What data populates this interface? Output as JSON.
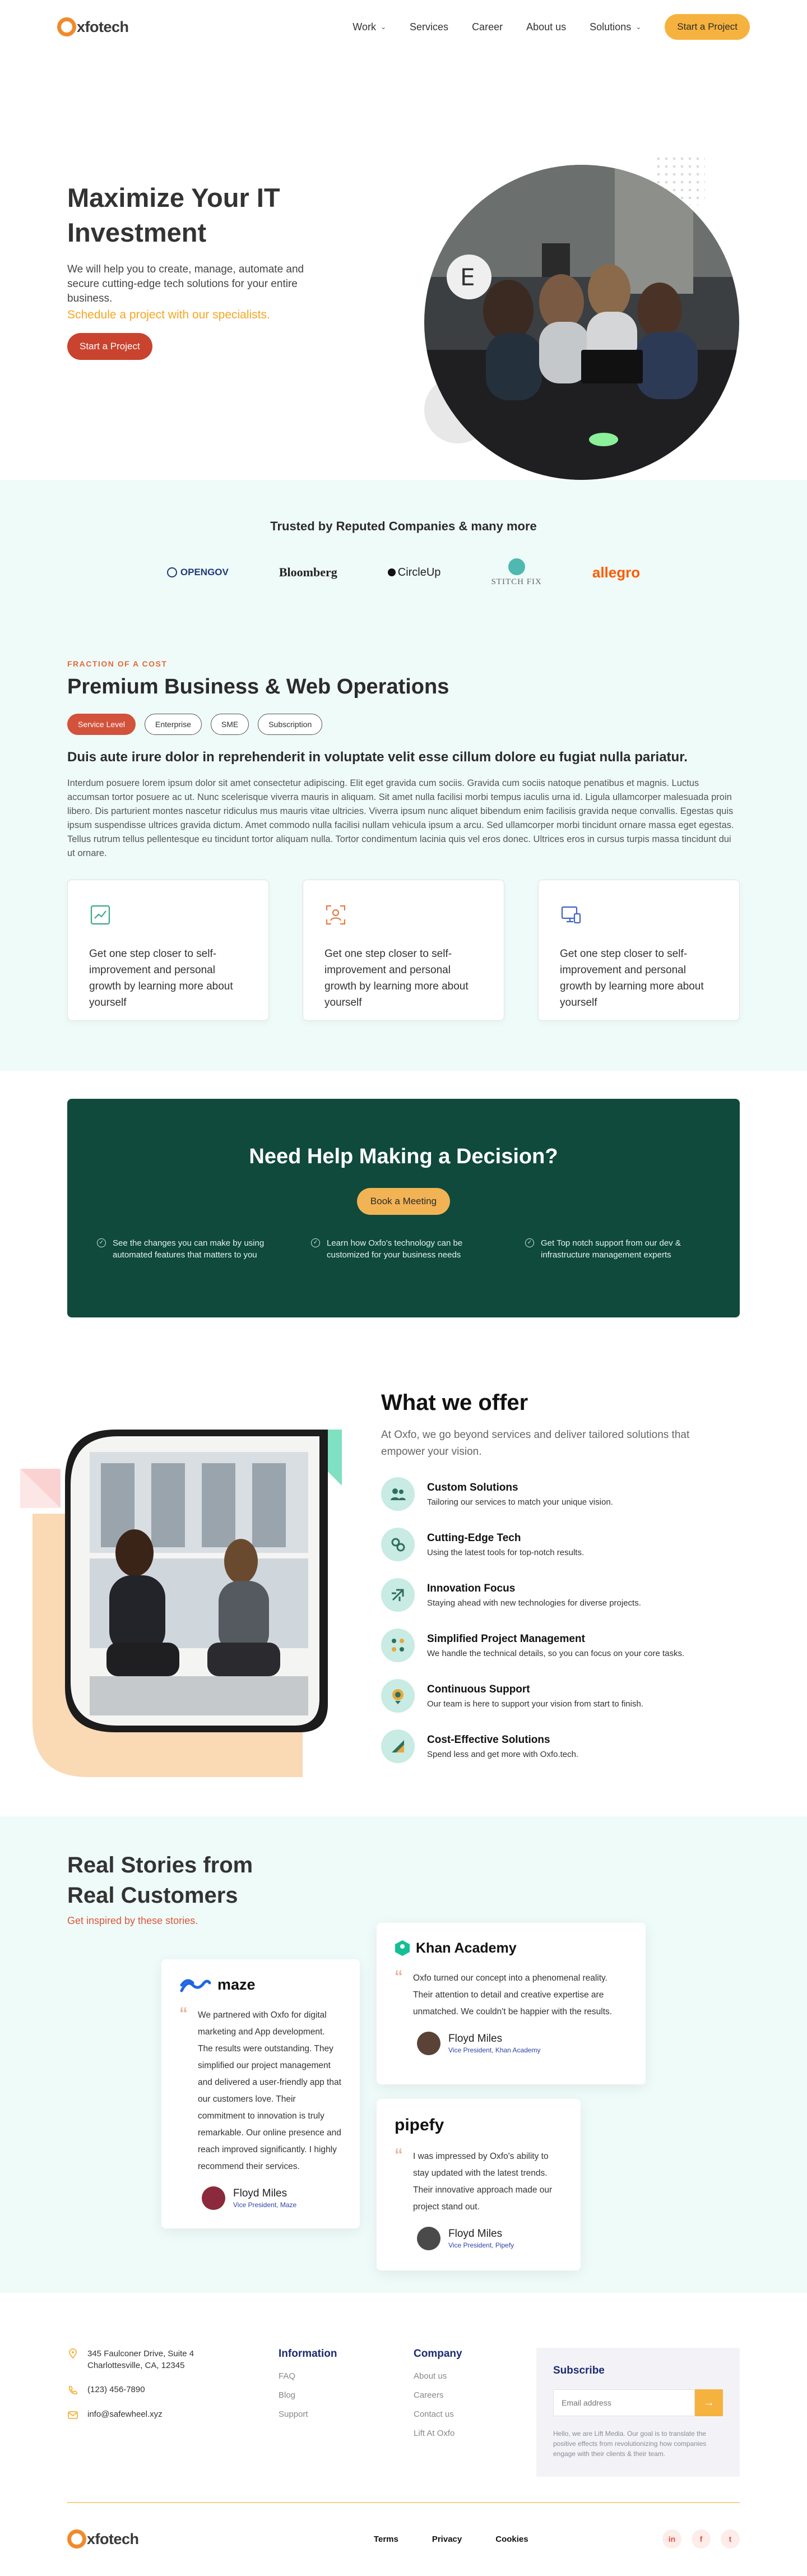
{
  "brand": {
    "name": "xfotech"
  },
  "nav": {
    "links": [
      {
        "label": "Work",
        "dropdown": true
      },
      {
        "label": "Services",
        "dropdown": false
      },
      {
        "label": "Career",
        "dropdown": false
      },
      {
        "label": "About us",
        "dropdown": false
      },
      {
        "label": "Solutions",
        "dropdown": true
      }
    ],
    "cta": "Start a  Project"
  },
  "hero": {
    "title": "Maximize Your IT Investment",
    "desc": "We will help you to create, manage, automate and secure cutting-edge tech solutions for your entire business.",
    "accent": "Schedule a project with our specialists.",
    "cta": "Start a  Project"
  },
  "trusted": {
    "title": "Trusted by Reputed Companies & many more",
    "logos": [
      "OPENGOV",
      "Bloomberg",
      "CircleUp",
      "STITCH FIX",
      "allegro"
    ]
  },
  "premium": {
    "eyebrow": "FRACTION OF A COST",
    "title": "Premium Business & Web Operations",
    "pills": [
      "Service Level",
      "Enterprise",
      "SME",
      "Subscription"
    ],
    "active_pill": "Service Level",
    "subtitle": "Duis aute irure dolor in reprehenderit in voluptate velit esse cillum dolore eu fugiat nulla pariatur.",
    "body": "Interdum posuere lorem ipsum dolor sit amet consectetur adipiscing. Elit eget gravida cum sociis. Gravida cum sociis natoque penatibus et magnis. Luctus accumsan tortor posuere ac ut. Nunc scelerisque viverra mauris in aliquam. Sit amet nulla facilisi morbi tempus iaculis urna id. Ligula ullamcorper malesuada proin libero. Dis parturient montes nascetur ridiculus mus mauris vitae ultricies. Viverra ipsum nunc aliquet bibendum enim facilisis gravida neque convallis. Egestas quis ipsum suspendisse ultrices gravida dictum. Amet commodo nulla facilisi nullam vehicula ipsum a arcu. Sed ullamcorper morbi tincidunt ornare massa eget egestas. Tellus rutrum tellus pellentesque eu tincidunt tortor aliquam nulla. Tortor condimentum lacinia quis vel eros donec. Ultrices eros in cursus turpis massa tincidunt dui ut ornare.",
    "cards": [
      {
        "icon": "chart-icon",
        "text": "Get one step closer to self-improvement and personal growth by learning more about yourself"
      },
      {
        "icon": "target-user-icon",
        "text": "Get one step closer to self-improvement and personal growth by learning more about yourself"
      },
      {
        "icon": "monitor-icon",
        "text": "Get one step closer to self-improvement and personal growth by learning more about yourself"
      }
    ]
  },
  "decision": {
    "title": "Need Help Making a Decision?",
    "cta": "Book a Meeting",
    "points": [
      "See the changes you can make by using automated features that matters  to you",
      "Learn how Oxfo's  technology can be customized for your business needs",
      "Get Top notch support from our dev & infrastructure management experts"
    ]
  },
  "offer": {
    "title": "What we offer",
    "subtitle": "At Oxfo, we go beyond services and deliver tailored solutions that empower your vision.",
    "items": [
      {
        "title": "Custom Solutions",
        "desc": "Tailoring our services to match your unique vision."
      },
      {
        "title": "Cutting-Edge Tech",
        "desc": "Using the latest tools for top-notch results."
      },
      {
        "title": "Innovation Focus",
        "desc": "Staying ahead with new technologies for diverse projects."
      },
      {
        "title": "Simplified Project Management",
        "desc": "We handle the technical details, so you can focus on your core tasks."
      },
      {
        "title": "Continuous Support",
        "desc": "Our team is here to support your vision from start to finish."
      },
      {
        "title": "Cost-Effective Solutions",
        "desc": "Spend less and get more with Oxfo.tech."
      }
    ]
  },
  "stories": {
    "title": "Real Stories from Real Customers",
    "subtitle": "Get inspired by these stories.",
    "testimonials": [
      {
        "brand": "maze",
        "text": "We partnered with Oxfo for digital marketing and App development. The results were outstanding. They simplified our project management and delivered a user-friendly app that our customers love. Their commitment to innovation is truly remarkable. Our online presence and reach improved significantly. I highly recommend their services.",
        "name": "Floyd Miles",
        "role": "Vice President, Maze"
      },
      {
        "brand": "Khan Academy",
        "text": "Oxfo turned our concept into a phenomenal reality. Their attention to detail and creative expertise are unmatched. We couldn't be happier with the results.",
        "name": "Floyd Miles",
        "role": "Vice President, Khan Academy"
      },
      {
        "brand": "pipefy",
        "text": "I was impressed by Oxfo's ability to stay updated with the latest trends. Their innovative approach made our project stand out.",
        "name": "Floyd Miles",
        "role": "Vice President, Pipefy"
      }
    ]
  },
  "footer": {
    "address": "345 Faulconer Drive, Suite 4 Charlottesville, CA, 12345",
    "phone": "(123) 456-7890",
    "email": "info@safewheel.xyz",
    "info_title": "Information",
    "info_links": [
      "FAQ",
      "Blog",
      "Support"
    ],
    "company_title": "Company",
    "company_links": [
      "About us",
      "Careers",
      "Contact us",
      "Lift At Oxfo"
    ],
    "subscribe_title": "Subscribe",
    "subscribe_placeholder": "Email address",
    "subscribe_note": "Hello, we are Lift Media. Our goal is to translate the positive effects from revolutionizing how companies engage with their clients & their team.",
    "legal": [
      "Terms",
      "Privacy",
      "Cookies"
    ],
    "socials": [
      "in",
      "f",
      "t"
    ]
  }
}
